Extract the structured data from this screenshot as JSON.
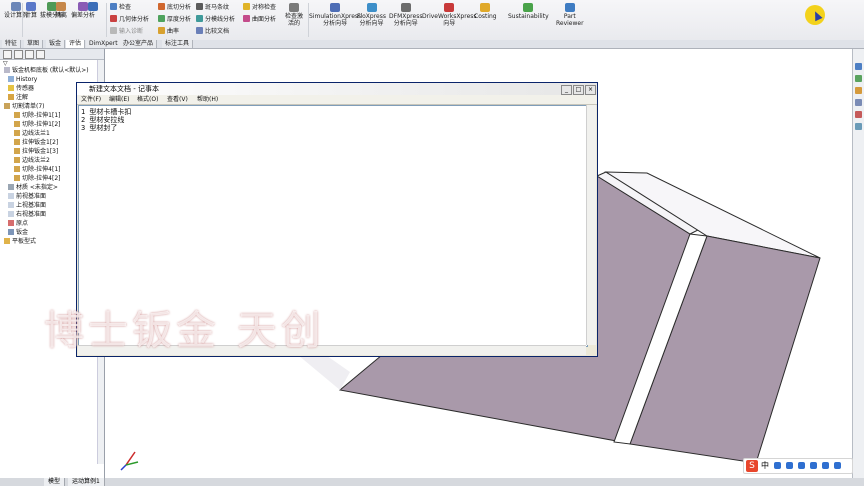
{
  "colors": {
    "viewport_bg": "#ffffff",
    "part_face": "#a898a8",
    "part_top": "#f7f6f9",
    "part_edge": "#2b2b2b",
    "ribbon_bg": "#eceef1",
    "watermark": "#ffffff",
    "ime_brand": "#e8462c",
    "user_dot": "#f3d21c"
  },
  "ribbon": {
    "left_group": [
      "设计算例",
      "计算",
      "拔模分析",
      "隔离",
      "偏差分析"
    ],
    "mid_col_a": [
      "检查",
      "几何体分析",
      "输入诊断"
    ],
    "mid_col_b": [
      "底切分析",
      "厚度分析",
      "曲率"
    ],
    "mid_col_c": [
      "斑马条纹",
      "分模线分析",
      "比较文档"
    ],
    "mid_col_d": [
      "对称检查",
      "曲面分析"
    ],
    "mid_col_e": [
      "检查激活的"
    ],
    "addins": [
      {
        "line1": "SimulationXpress",
        "line2": "分析向导"
      },
      {
        "line1": "FloXpress",
        "line2": "分析向导"
      },
      {
        "line1": "DFMXpress",
        "line2": "分析向导"
      },
      {
        "line1": "DriveWorksXpress",
        "line2": "向导"
      },
      {
        "line1": "Costing",
        "line2": ""
      },
      {
        "line1": "Sustainability",
        "line2": ""
      },
      {
        "line1": "Part",
        "line2": "Reviewer"
      }
    ]
  },
  "command_tabs": [
    "特征",
    "草图",
    "钣金",
    "评估",
    "DimXpert",
    "办公室产品",
    "标注工具"
  ],
  "tree": {
    "items": [
      "钣金机柜底板 (默认<默认>)",
      "History",
      "传感器",
      "注解",
      "切割清单(7)",
      "切除-拉伸1[1]",
      "切除-拉伸1[2]",
      "边线法兰1",
      "拉伸钣金1[2]",
      "拉伸钣金1[3]",
      "边线法兰2",
      "切除-拉伸4[1]",
      "切除-拉伸4[2]",
      "材质 <未指定>",
      "前视基准面",
      "上视基准面",
      "右视基准面",
      "原点",
      "钣金",
      "平板型式"
    ]
  },
  "notepad": {
    "title": "新建文本文档 - 记事本",
    "menu": [
      "文件(F)",
      "编辑(E)",
      "格式(O)",
      "查看(V)",
      "帮助(H)"
    ],
    "lines": [
      "1 型材卡槽卡扣",
      "2 型材安拉线",
      "3 型材封了"
    ]
  },
  "watermark": "博士钣金 天创",
  "bottom_tabs": [
    "模型",
    "运动算例1"
  ],
  "ime": {
    "zh": "中"
  }
}
